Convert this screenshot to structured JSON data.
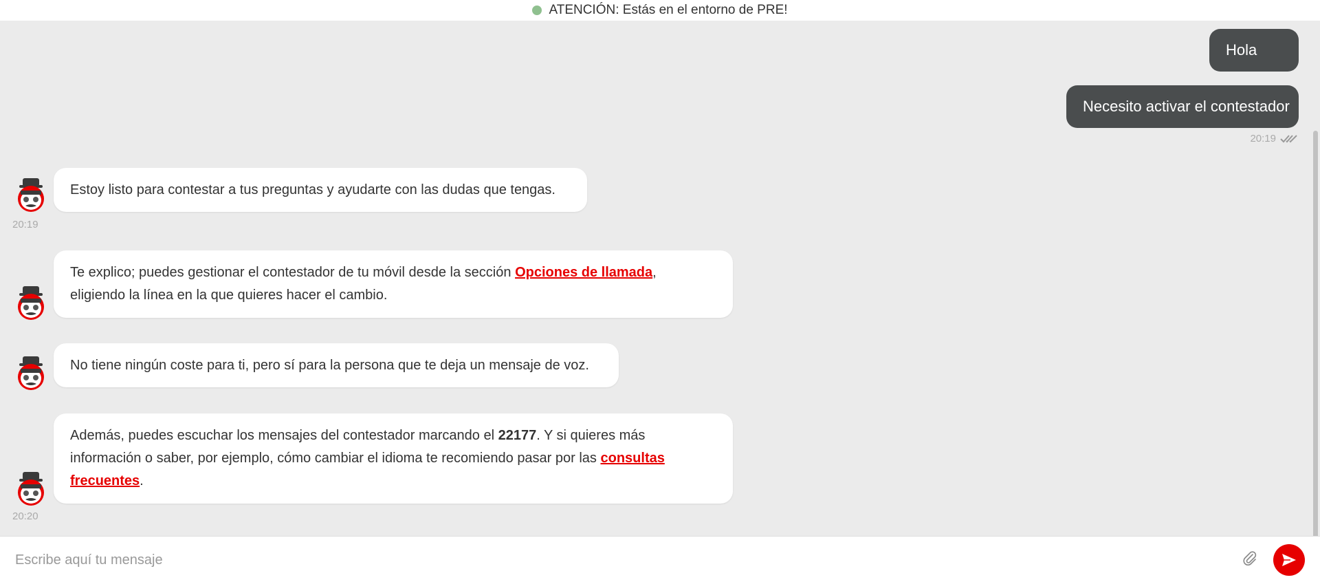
{
  "banner": {
    "text": "ATENCIÓN: Estás en el entorno de PRE!",
    "dot_color": "#8fc08f"
  },
  "user_messages": [
    {
      "text": "Hola"
    },
    {
      "text": "Necesito activar el contestador"
    }
  ],
  "user_meta": {
    "time": "20:19",
    "status_icon": "double-check-icon"
  },
  "bot_messages": [
    {
      "text": "Estoy listo para contestar a tus preguntas y ayudarte con las dudas que tengas.",
      "time": "20:19"
    },
    {
      "text_before": "Te explico; puedes gestionar el contestador de tu móvil desde la sección ",
      "link": "Opciones de llamada",
      "text_after_link": ",",
      "line2": "eligiendo la línea en la que quieres hacer el cambio."
    },
    {
      "text": "No tiene ningún coste para ti, pero sí para la persona que te deja un mensaje de voz."
    },
    {
      "text_a": "Además, puedes escuchar los mensajes del contestador marcando el ",
      "bold": "22177",
      "text_b": ". Y si quieres más",
      "line2": "información o saber, por ejemplo, cómo cambiar el idioma te recomiendo pasar por las ",
      "link_part1": "consultas ",
      "link_part2": "frecuentes",
      "end": ".",
      "time": "20:20"
    }
  ],
  "input": {
    "placeholder": "Escribe aquí tu mensaje",
    "value": ""
  },
  "icons": {
    "attach": "paperclip-icon",
    "send": "send-icon",
    "avatar": "bot-avatar-icon"
  },
  "colors": {
    "accent": "#e60000",
    "user_bubble": "#4a4d4e",
    "background": "#ebebeb"
  }
}
